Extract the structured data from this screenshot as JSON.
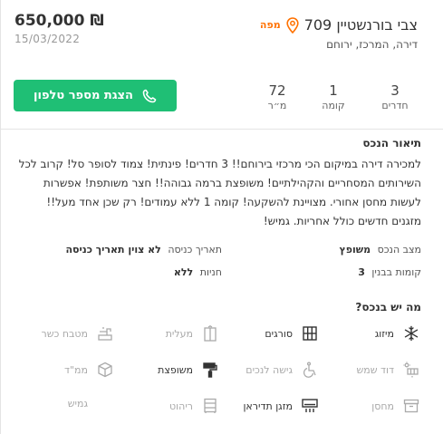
{
  "listing": {
    "price": "650,000 ₪",
    "date": "15/03/2022",
    "title": "צבי בורנשטיין 709",
    "map_label": "מפה",
    "subtitle": "דירה, המרכז, ירוחם",
    "phone_button": "הצגת מספר טלפון",
    "accent_color": "#1fbf75",
    "map_color": "#ff7100"
  },
  "stats": [
    {
      "value": "3",
      "label": "חדרים"
    },
    {
      "value": "1",
      "label": "קומה"
    },
    {
      "value": "72",
      "label": "מ״ר"
    }
  ],
  "description": {
    "title": "תיאור הנכס",
    "text": "למכירה דירה במיקום הכי מרכזי בירוחם!! 3 חדרים! פינתית! צמוד לסופר סל! קרוב לכל השירותים המסחריים והקהילתיים! משופצת ברמה גבוהה!! חצר משותפת! אפשרות לעשות מחסן אחורי. מצויינת להשקעה! קומה 1 ללא עמודים! רק שכן אחד מעל!! מזגנים חדשים כולל אחריות. גמיש!"
  },
  "details": [
    {
      "label": "מצב הנכס",
      "value": "משופץ"
    },
    {
      "label": "תאריך כניסה",
      "value": "לא צוין תאריך כניסה"
    },
    {
      "label": "קומות בבנין",
      "value": "3"
    },
    {
      "label": "חניות",
      "value": "ללא"
    }
  ],
  "features": {
    "title": "מה יש בנכס?",
    "items": [
      {
        "label": "מיזוג",
        "available": true,
        "icon": "snowflake-icon"
      },
      {
        "label": "סורגים",
        "available": true,
        "icon": "window-bars-icon"
      },
      {
        "label": "מעלית",
        "available": false,
        "icon": "elevator-icon"
      },
      {
        "label": "מטבח כשר",
        "available": false,
        "icon": "faucet-icon"
      },
      {
        "label": "דוד שמש",
        "available": false,
        "icon": "solar-heater-icon"
      },
      {
        "label": "גישה לנכים",
        "available": false,
        "icon": "wheelchair-icon"
      },
      {
        "label": "משופצת",
        "available": true,
        "icon": "paint-roller-icon"
      },
      {
        "label": "ממ\"ד",
        "available": false,
        "icon": "shelter-box-icon"
      },
      {
        "label": "מחסן",
        "available": false,
        "icon": "storage-box-icon"
      },
      {
        "label": "מזגן תדיראן",
        "available": true,
        "icon": "air-conditioner-icon"
      },
      {
        "label": "ריהוט",
        "available": false,
        "icon": "furniture-icon"
      },
      {
        "label": "גמיש",
        "available": false,
        "icon": ""
      }
    ]
  }
}
